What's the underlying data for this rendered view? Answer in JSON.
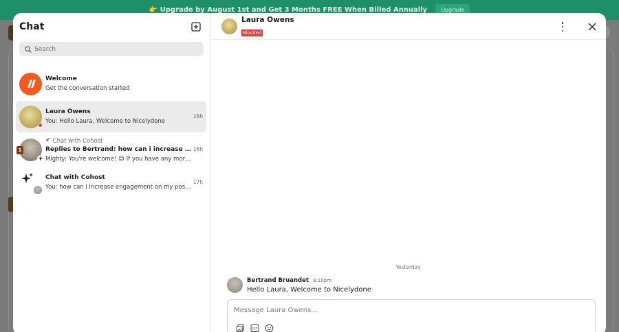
{
  "banner": {
    "text": "👉 Upgrade by August 1st and Get 3 Months FREE When Billed Annually",
    "button": "Upgrade"
  },
  "colors": {
    "banner_bg": "#1f8f6a",
    "welcome_orange": "#f25a1f",
    "blocked_red": "#e63b3b",
    "active_row": "#ebebeb"
  },
  "sidebar": {
    "title": "Chat",
    "new_chat_icon": "compose-plus-icon",
    "search": {
      "placeholder": "Search"
    },
    "conversations": [
      {
        "name": "Welcome",
        "preview": "Get the conversation started",
        "time": ""
      },
      {
        "name": "Laura Owens",
        "preview": "You: Hello Laura, Welcome to Nicelydone",
        "time": "16h",
        "active": true,
        "status": "blocked"
      },
      {
        "context": "Chat with Cohost",
        "name": "Replies to Bertrand: how can i increase engagement...",
        "preview": "Mighty: You're welcome! 😊 If you have any more que...",
        "time": "16h",
        "badge": "1"
      },
      {
        "name": "Chat with Cohost",
        "preview": "You: how can i increase engagement on my posts?",
        "time": "17h"
      }
    ]
  },
  "thread": {
    "contact_name": "Laura Owens",
    "status_badge": "Blocked",
    "day_separator": "Yesterday",
    "messages": [
      {
        "author": "Bertrand Bruandet",
        "time": "8:10pm",
        "text": "Hello Laura, Welcome to Nicelydone"
      }
    ],
    "composer": {
      "placeholder": "Message Laura Owens...",
      "tools": [
        "image-icon",
        "gif-icon",
        "emoji-icon"
      ]
    }
  }
}
